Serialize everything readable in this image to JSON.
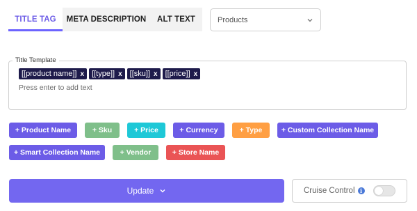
{
  "tabs": [
    {
      "label": "TITLE TAG",
      "active": true
    },
    {
      "label": "META DESCRIPTION",
      "active": false
    },
    {
      "label": "ALT TEXT",
      "active": false
    }
  ],
  "product_select": {
    "value": "Products",
    "icon": "chevron-down-icon"
  },
  "template": {
    "legend": "Title Template",
    "tokens": [
      "[[product name]]",
      "[[type]]",
      "[[sku]]",
      "[[price]]"
    ],
    "remove_glyph": "x",
    "placeholder": "Press enter to add text"
  },
  "variables": [
    {
      "label": "+ Product Name",
      "color": "#6c5ce7"
    },
    {
      "label": "+ Sku",
      "color": "#7fbf8a"
    },
    {
      "label": "+ Price",
      "color": "#1ec8d7"
    },
    {
      "label": "+ Currency",
      "color": "#6c5ce7"
    },
    {
      "label": "+ Type",
      "color": "#ff9f43"
    },
    {
      "label": "+ Custom Collection Name",
      "color": "#6c5ce7"
    },
    {
      "label": "+ Smart Collection Name",
      "color": "#6c5ce7"
    },
    {
      "label": "+ Vendor",
      "color": "#7fbf8a"
    },
    {
      "label": "+ Store Name",
      "color": "#ea5455"
    }
  ],
  "update_button": {
    "label": "Update",
    "icon": "chevron-down-icon",
    "color": "#7367f0"
  },
  "cruise_control": {
    "label": "Cruise Control",
    "info_glyph": "i",
    "enabled": false
  }
}
